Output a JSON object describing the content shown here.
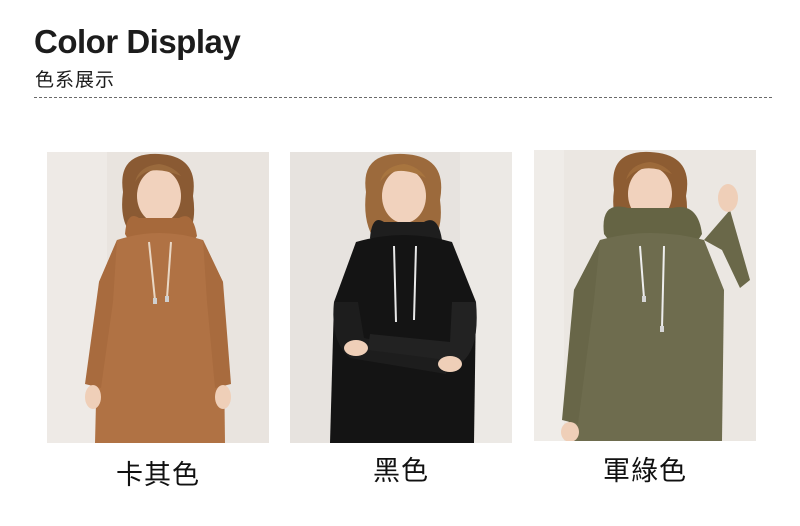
{
  "header": {
    "title": "Color Display",
    "subtitle": "色系展示"
  },
  "products": [
    {
      "label": "卡其色",
      "image": "model-khaki-hoodie-dress-photo",
      "dress_color": "#b07244",
      "bg_color": "#e9e4df"
    },
    {
      "label": "黑色",
      "image": "model-black-hoodie-dress-photo",
      "dress_color": "#141414",
      "bg_color": "#e7e3df"
    },
    {
      "label": "軍綠色",
      "image": "model-army-green-hoodie-dress-photo",
      "dress_color": "#6e6c4e",
      "bg_color": "#ebe7e2"
    }
  ]
}
